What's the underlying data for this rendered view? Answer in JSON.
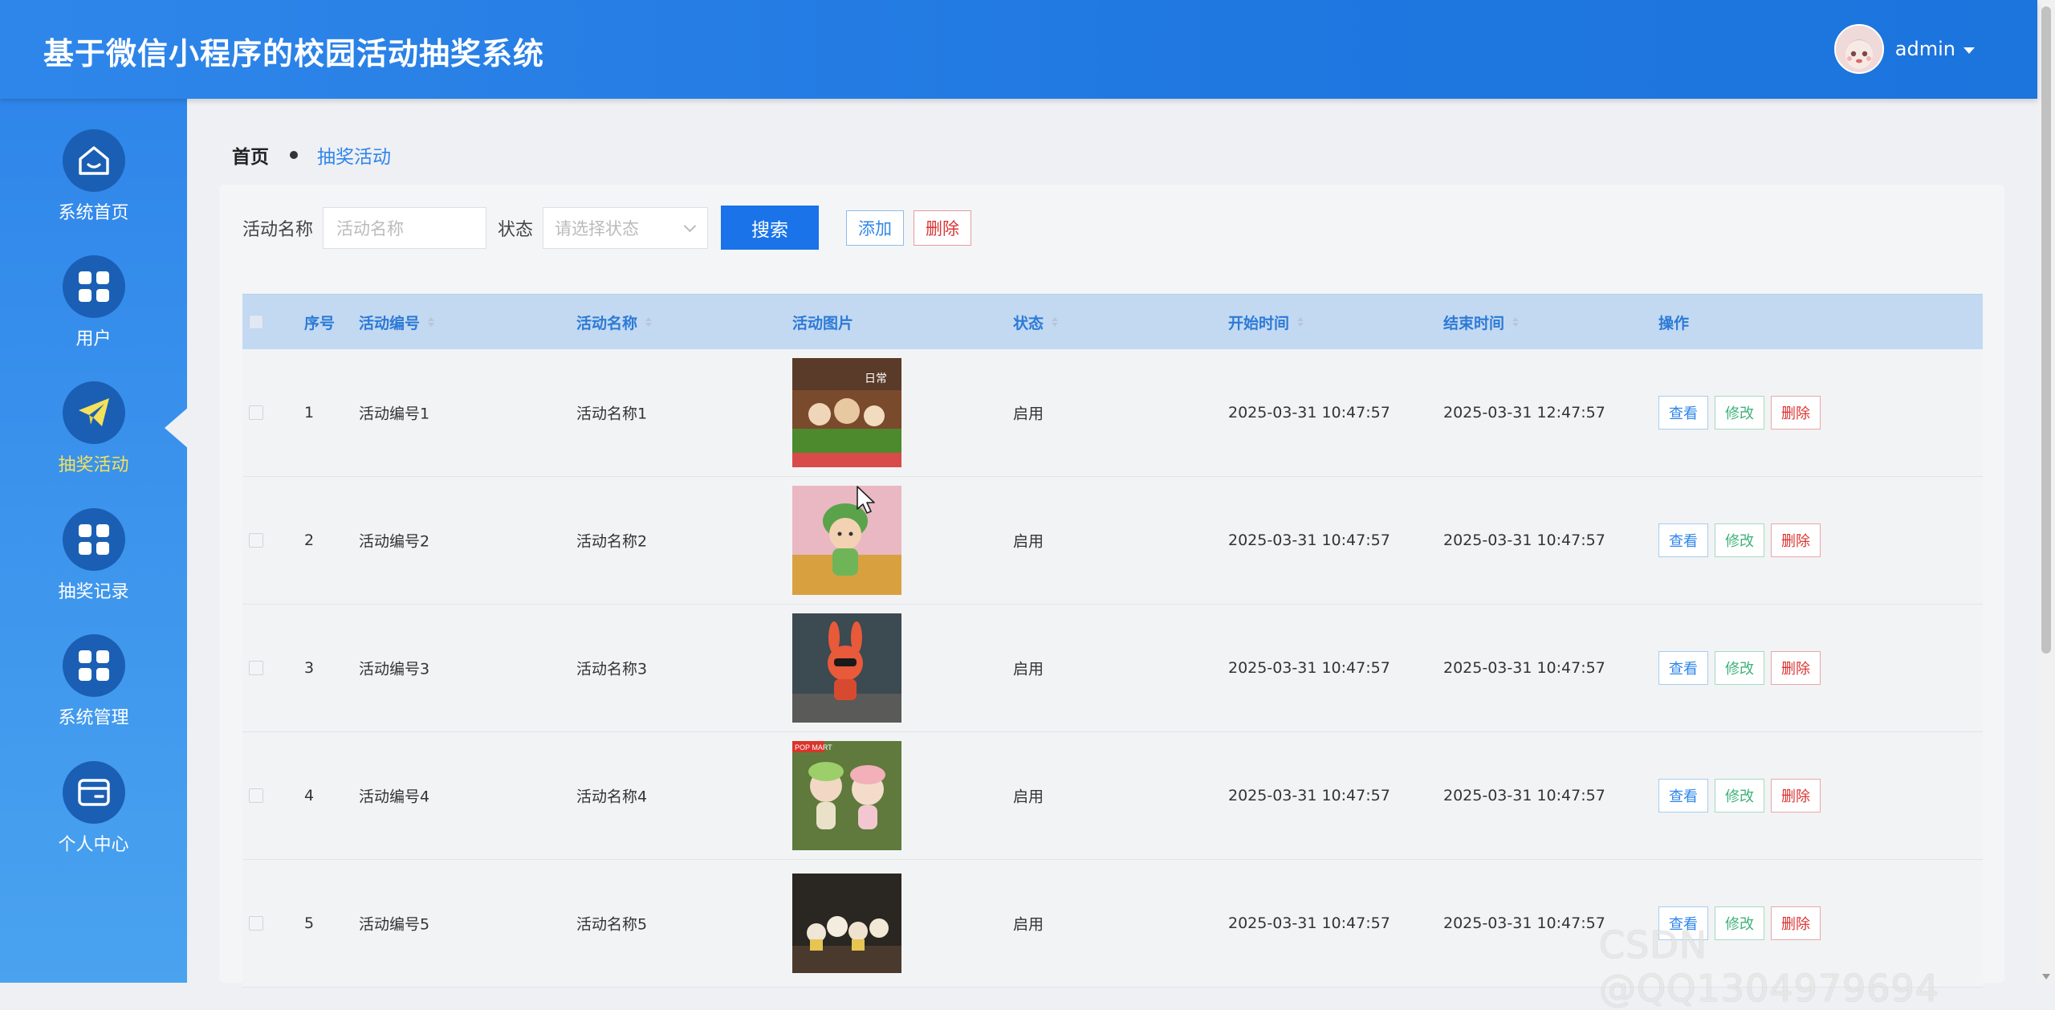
{
  "header": {
    "title": "基于微信小程序的校园活动抽奖系统",
    "user": "admin"
  },
  "sidebar": {
    "items": [
      {
        "label": "系统首页",
        "icon": "home-icon"
      },
      {
        "label": "用户",
        "icon": "grid-icon"
      },
      {
        "label": "抽奖活动",
        "icon": "paper-plane-icon",
        "active": true
      },
      {
        "label": "抽奖记录",
        "icon": "grid-icon"
      },
      {
        "label": "系统管理",
        "icon": "grid-icon"
      },
      {
        "label": "个人中心",
        "icon": "card-icon"
      }
    ]
  },
  "breadcrumb": {
    "home": "首页",
    "current": "抽奖活动"
  },
  "search": {
    "name_label": "活动名称",
    "name_placeholder": "活动名称",
    "status_label": "状态",
    "status_placeholder": "请选择状态",
    "search_button": "搜索",
    "add_button": "添加",
    "delete_button": "删除"
  },
  "table": {
    "columns": [
      "序号",
      "活动编号",
      "活动名称",
      "活动图片",
      "状态",
      "开始时间",
      "结束时间",
      "操作"
    ],
    "actions": {
      "view": "查看",
      "edit": "修改",
      "delete": "删除"
    },
    "rows": [
      {
        "no": "1",
        "code": "活动编号1",
        "name": "活动名称1",
        "status": "启用",
        "start": "2025-03-31 10:47:57",
        "end": "2025-03-31 12:47:57"
      },
      {
        "no": "2",
        "code": "活动编号2",
        "name": "活动名称2",
        "status": "启用",
        "start": "2025-03-31 10:47:57",
        "end": "2025-03-31 10:47:57"
      },
      {
        "no": "3",
        "code": "活动编号3",
        "name": "活动名称3",
        "status": "启用",
        "start": "2025-03-31 10:47:57",
        "end": "2025-03-31 10:47:57"
      },
      {
        "no": "4",
        "code": "活动编号4",
        "name": "活动名称4",
        "status": "启用",
        "start": "2025-03-31 10:47:57",
        "end": "2025-03-31 10:47:57"
      },
      {
        "no": "5",
        "code": "活动编号5",
        "name": "活动名称5",
        "status": "启用",
        "start": "2025-03-31 10:47:57",
        "end": "2025-03-31 10:47:57"
      }
    ]
  },
  "watermark": "CSDN @QQ1304979694",
  "colors": {
    "primary": "#1a73e8",
    "active_nav": "#f5e25b",
    "danger": "#dd3333",
    "success": "#3fb27a"
  }
}
